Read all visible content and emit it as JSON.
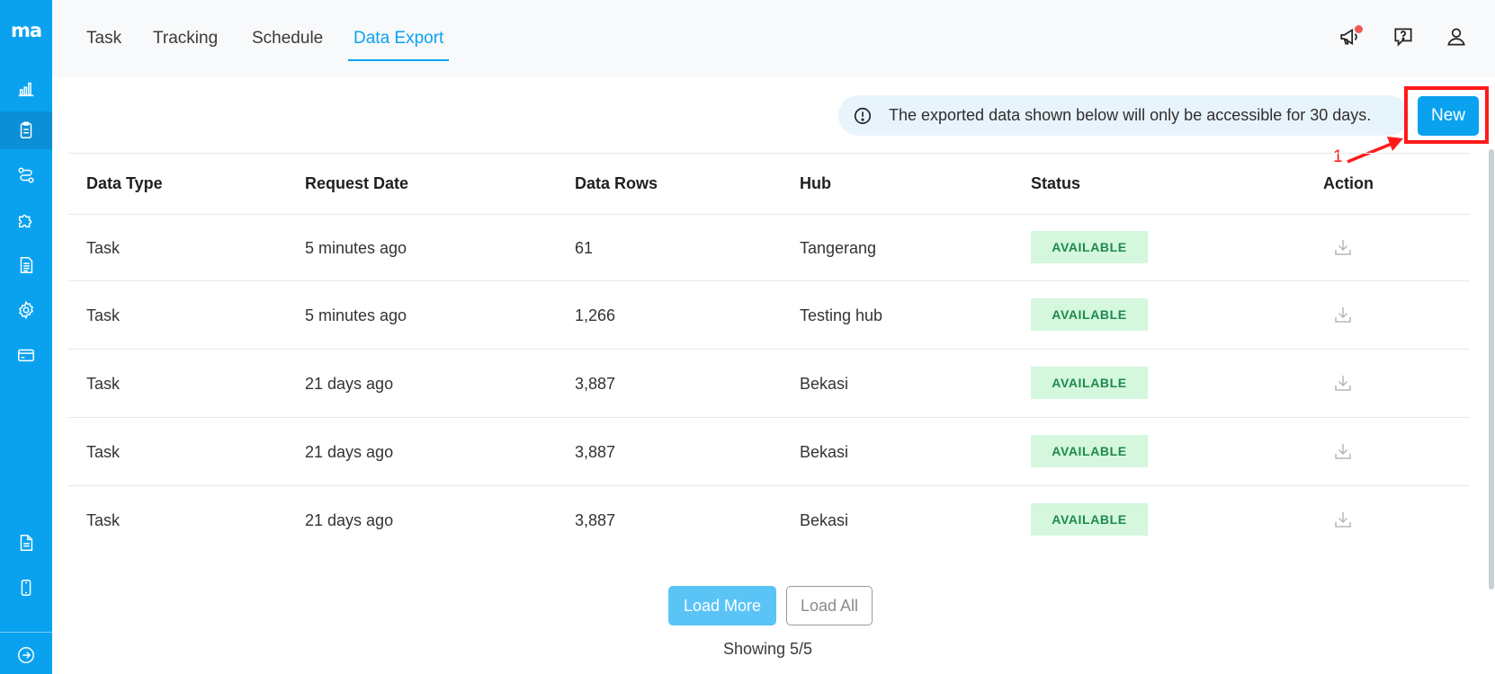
{
  "app": {
    "logo": "ma"
  },
  "sidebar": {
    "items": [
      {
        "icon": "chart-bar-icon",
        "active": false
      },
      {
        "icon": "clipboard-icon",
        "active": true
      },
      {
        "icon": "route-icon",
        "active": false
      },
      {
        "icon": "puzzle-icon",
        "active": false
      },
      {
        "icon": "document-icon",
        "active": false
      },
      {
        "icon": "gear-icon",
        "active": false
      },
      {
        "icon": "credit-card-icon",
        "active": false
      },
      {
        "icon": "file-text-icon",
        "active": false
      },
      {
        "icon": "mobile-phone-icon",
        "active": false
      },
      {
        "icon": "arrow-right-circle-icon",
        "active": false
      }
    ]
  },
  "nav": {
    "tabs": [
      {
        "label": "Task",
        "active": false
      },
      {
        "label": "Tracking",
        "active": false
      },
      {
        "label": "Schedule",
        "active": false
      },
      {
        "label": "Data Export",
        "active": true
      }
    ],
    "icons": [
      "megaphone-icon",
      "help-chat-icon",
      "user-icon"
    ]
  },
  "notice": {
    "text": "The exported data shown below will only be accessible for 30 days."
  },
  "toolbar": {
    "new_label": "New"
  },
  "annotation": {
    "number": "1",
    "color": "#ff1a1a"
  },
  "table": {
    "headers": [
      "Data Type",
      "Request Date",
      "Data Rows",
      "Hub",
      "Status",
      "Action"
    ],
    "rows": [
      {
        "type": "Task",
        "date": "5 minutes ago",
        "rows": "61",
        "hub": "Tangerang",
        "status": "AVAILABLE"
      },
      {
        "type": "Task",
        "date": "5 minutes ago",
        "rows": "1,266",
        "hub": "Testing hub",
        "status": "AVAILABLE"
      },
      {
        "type": "Task",
        "date": "21 days ago",
        "rows": "3,887",
        "hub": "Bekasi",
        "status": "AVAILABLE"
      },
      {
        "type": "Task",
        "date": "21 days ago",
        "rows": "3,887",
        "hub": "Bekasi",
        "status": "AVAILABLE"
      },
      {
        "type": "Task",
        "date": "21 days ago",
        "rows": "3,887",
        "hub": "Bekasi",
        "status": "AVAILABLE"
      }
    ]
  },
  "pagination": {
    "load_more_label": "Load More",
    "load_all_label": "Load All",
    "showing_text": "Showing 5/5"
  },
  "colors": {
    "accent": "#0aa2ef",
    "badge_bg": "#d4f7de",
    "badge_text": "#1c8a4b"
  }
}
